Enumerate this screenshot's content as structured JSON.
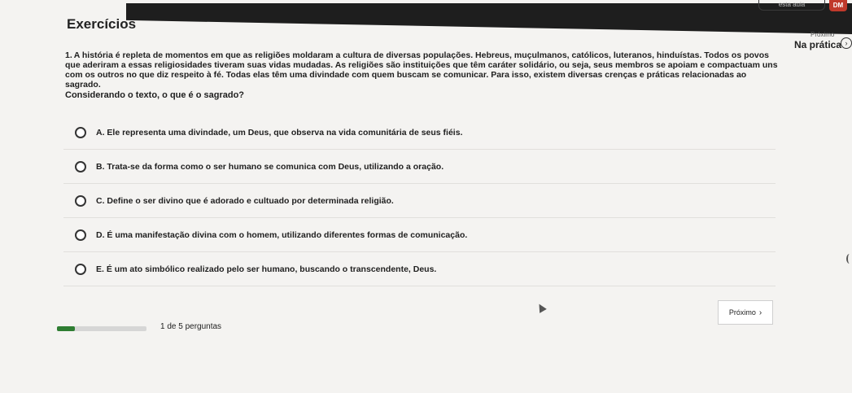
{
  "header": {
    "title": "Exercícios",
    "top_pill": "esta aula",
    "avatar": "DM",
    "next_small": "Próximo",
    "next_section": "Na prática"
  },
  "question": {
    "number": "1.",
    "text": "A história é repleta de momentos em que as religiões moldaram a cultura de diversas populações. Hebreus, muçulmanos, católicos, luteranos, hinduístas. Todos os povos que aderiram a essas religiosidades tiveram suas vidas mudadas. As religiões são instituições que têm caráter solidário, ou seja, seus membros se apoiam e compactuam uns com os outros no que diz respeito à fé. Todas elas têm uma divindade com quem buscam se comunicar. Para isso, existem diversas crenças e práticas relacionadas ao sagrado.",
    "prompt": "Considerando o texto, o que é o sagrado?"
  },
  "options": [
    {
      "label": "A. Ele representa uma divindade, um Deus, que observa na vida comunitária de seus fiéis."
    },
    {
      "label": "B. Trata-se da forma como o ser humano se comunica com Deus, utilizando a oração."
    },
    {
      "label": "C. Define o ser divino que é adorado e cultuado por determinada religião."
    },
    {
      "label": "D. É uma manifestação divina com o homem, utilizando diferentes formas de comunicação."
    },
    {
      "label": "E. É um ato simbólico realizado pelo ser humano, buscando o transcendente, Deus."
    }
  ],
  "footer": {
    "progress_text": "1 de 5 perguntas",
    "progress_fraction": 0.2,
    "next_button": "Próximo",
    "progress_color": "#2e7d32"
  }
}
